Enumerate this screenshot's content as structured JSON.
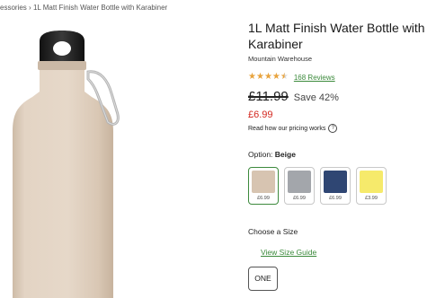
{
  "breadcrumb": {
    "parent": "essories",
    "separator": "›",
    "current": "1L Matt Finish Water Bottle with Karabiner"
  },
  "product": {
    "title": "1L Matt Finish Water Bottle with Karabiner",
    "brand": "Mountain Warehouse",
    "rating_value": 4.5,
    "reviews_label": "168 Reviews",
    "was_price": "£11.99",
    "save_text": "Save 42%",
    "now_price": "£6.99",
    "pricing_link": "Read how our pricing works",
    "help_icon": "?"
  },
  "options": {
    "label": "Option:",
    "selected": "Beige",
    "swatches": [
      {
        "name": "Beige",
        "price": "£6.99",
        "color": "#d7c4b1",
        "selected": true
      },
      {
        "name": "Grey",
        "price": "£6.99",
        "color": "#a3a6ab",
        "selected": false
      },
      {
        "name": "Navy",
        "price": "£6.99",
        "color": "#2f4673",
        "selected": false
      },
      {
        "name": "Yellow",
        "price": "£3.99",
        "color": "#f6ea6b",
        "selected": false
      }
    ]
  },
  "size": {
    "label": "Choose a Size",
    "guide_link": "View Size Guide",
    "options": [
      "ONE"
    ]
  },
  "colors": {
    "accent_green": "#3b8a3b",
    "price_red": "#d3271f",
    "star": "#e8a33d",
    "bottle": "#e2d3c3"
  }
}
